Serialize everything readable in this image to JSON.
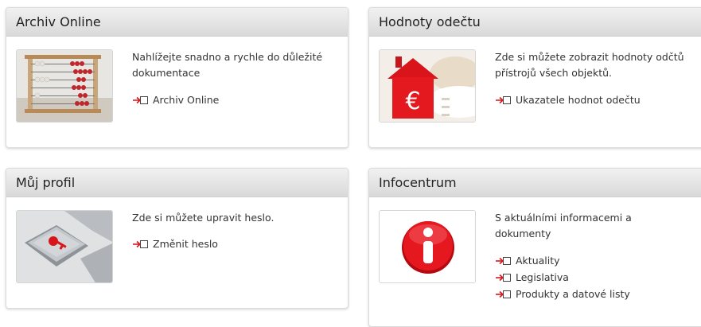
{
  "cards": [
    {
      "title": "Archiv Online",
      "description": "Nahlížejte snadno a rychle do důležité dokumentace",
      "image_icon": "abacus-image",
      "links": [
        "Archiv Online"
      ]
    },
    {
      "title": "Hodnoty odečtu",
      "description": "Zde si můžete zobrazit hodnoty odčtů přístrojů všech objektů.",
      "image_icon": "euro-house-image",
      "links": [
        "Ukazatele hodnot odečtu"
      ]
    },
    {
      "title": "Můj profil",
      "description": "Zde si můžete upravit heslo.",
      "image_icon": "keyboard-key-image",
      "links": [
        "Změnit heslo"
      ]
    },
    {
      "title": "Infocentrum",
      "description": "S aktuálními informacemi a dokumenty",
      "image_icon": "info-sign-image",
      "links": [
        "Aktuality",
        "Legislativa",
        "Produkty a datové listy"
      ]
    }
  ],
  "colors": {
    "accent": "#d9141b",
    "header_top": "#f1f1f1",
    "header_bottom": "#d9d9d9"
  }
}
